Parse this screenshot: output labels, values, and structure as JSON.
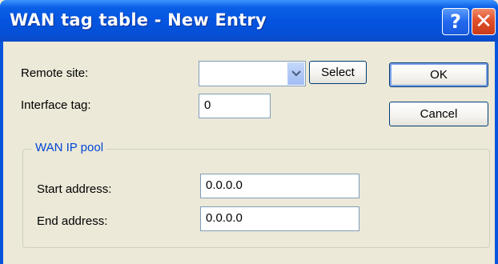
{
  "dialog": {
    "title": "WAN tag table - New Entry",
    "help_glyph": "?",
    "close_glyph": "✕"
  },
  "form": {
    "remote_site_label": "Remote site:",
    "remote_site_value": "",
    "select_button": "Select",
    "interface_tag_label": "Interface tag:",
    "interface_tag_value": "0"
  },
  "buttons": {
    "ok": "OK",
    "cancel": "Cancel"
  },
  "wan_ip_pool": {
    "title": "WAN IP pool",
    "start_label": "Start address:",
    "start_value": "0.0.0.0",
    "end_label": "End address:",
    "end_value": "0.0.0.0"
  },
  "icons": {
    "dropdown": "chevron-down-icon",
    "help": "help-icon",
    "close": "close-icon"
  },
  "colors": {
    "titlebar": "#0554e0",
    "dialog_bg": "#ece9d8",
    "group_title": "#0046d5",
    "close_button": "#e0502a"
  }
}
